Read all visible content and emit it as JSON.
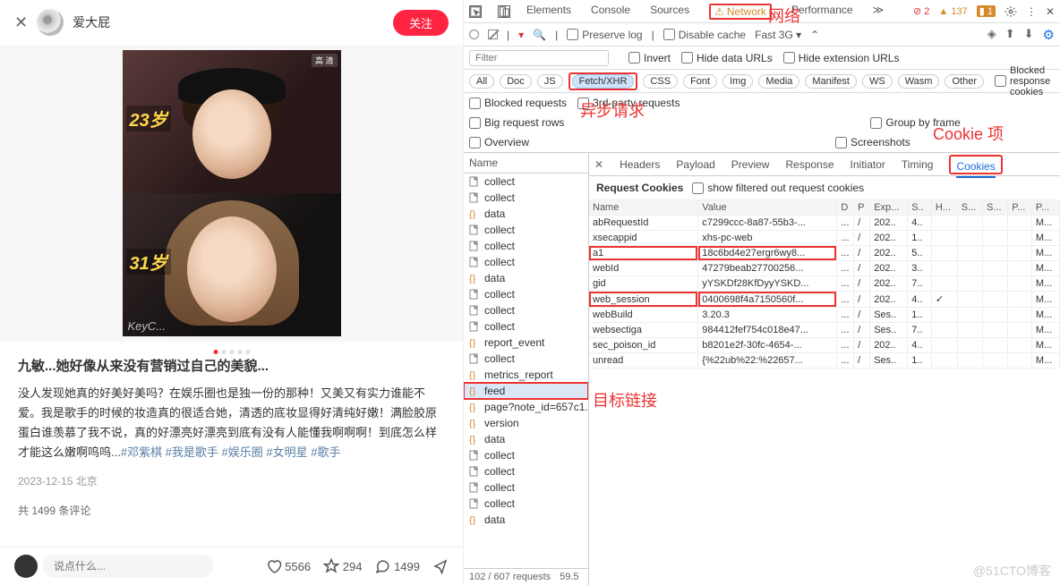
{
  "left": {
    "username": "爱大屁",
    "follow": "关注",
    "age1": "23岁",
    "age2": "31岁",
    "hd": "高 清",
    "sig": "KeyC...",
    "title": "九敏...她好像从来没有营销过自己的美貌...",
    "body": "没人发现她真的好美好美吗？在娱乐圈也是独一份的那种！又美又有实力谁能不爱。我是歌手的时候的妆造真的很适合她，清透的底妆显得好清纯好嫩！满脸胶原蛋白谁羡慕了我不说，真的好漂亮好漂亮到底有没有人能懂我啊啊啊！到底怎么样才能这么嫩啊呜呜...",
    "tags": "#邓紫棋 #我是歌手 #娱乐圈 #女明星 #歌手",
    "meta": "2023-12-15 北京",
    "comments_line": "共 1499 条评论",
    "placeholder": "说点什么...",
    "likes": "5566",
    "stars": "294",
    "cmts": "1499"
  },
  "dev": {
    "tabs": [
      "Elements",
      "Console",
      "Sources",
      "Network",
      "Performance"
    ],
    "err": "2",
    "warn": "137",
    "info": "1",
    "toolbar": {
      "preserve": "Preserve log",
      "disable": "Disable cache",
      "throttle": "Fast 3G"
    },
    "filter_placeholder": "Filter",
    "invert": "Invert",
    "hide_urls": "Hide data URLs",
    "hide_ext": "Hide extension URLs",
    "chips": [
      "All",
      "Doc",
      "JS",
      "Fetch/XHR",
      "CSS",
      "Font",
      "Img",
      "Media",
      "Manifest",
      "WS",
      "Wasm",
      "Other"
    ],
    "blocked_cookies": "Blocked response cookies",
    "opts": {
      "blocked": "Blocked requests",
      "third": "3rd-party requests",
      "big": "Big request rows",
      "group": "Group by frame",
      "overview": "Overview",
      "screens": "Screenshots"
    },
    "name_hdr": "Name",
    "requests": [
      {
        "t": "f",
        "n": "collect"
      },
      {
        "t": "f",
        "n": "collect"
      },
      {
        "t": "x",
        "n": "data"
      },
      {
        "t": "f",
        "n": "collect"
      },
      {
        "t": "f",
        "n": "collect"
      },
      {
        "t": "f",
        "n": "collect"
      },
      {
        "t": "x",
        "n": "data"
      },
      {
        "t": "f",
        "n": "collect"
      },
      {
        "t": "f",
        "n": "collect"
      },
      {
        "t": "f",
        "n": "collect"
      },
      {
        "t": "x",
        "n": "report_event"
      },
      {
        "t": "f",
        "n": "collect"
      },
      {
        "t": "x",
        "n": "metrics_report"
      },
      {
        "t": "x",
        "n": "feed",
        "sel": true
      },
      {
        "t": "x",
        "n": "page?note_id=657c1..."
      },
      {
        "t": "x",
        "n": "version"
      },
      {
        "t": "x",
        "n": "data"
      },
      {
        "t": "f",
        "n": "collect"
      },
      {
        "t": "f",
        "n": "collect"
      },
      {
        "t": "f",
        "n": "collect"
      },
      {
        "t": "f",
        "n": "collect"
      },
      {
        "t": "x",
        "n": "data"
      }
    ],
    "req_count": "102 / 607 requests",
    "req_size": "59.5",
    "det_tabs": [
      "Headers",
      "Payload",
      "Preview",
      "Response",
      "Initiator",
      "Timing",
      "Cookies"
    ],
    "req_cookies": "Request Cookies",
    "show_filtered": "show filtered out request cookies",
    "cols": [
      "Name",
      "Value",
      "D",
      "P",
      "Exp...",
      "S..",
      "H...",
      "S...",
      "S...",
      "P...",
      "P..."
    ],
    "rows": [
      {
        "n": "abRequestId",
        "v": "c7299ccc-8a87-55b3-...",
        "d": "...",
        "p": "/",
        "e": "202..",
        "s": "4..",
        "h": "",
        "sa": "",
        "sc": "",
        "pr": "",
        "pa": "M..."
      },
      {
        "n": "xsecappid",
        "v": "xhs-pc-web",
        "d": "...",
        "p": "/",
        "e": "202..",
        "s": "1..",
        "h": "",
        "sa": "",
        "sc": "",
        "pr": "",
        "pa": "M..."
      },
      {
        "n": "a1",
        "v": "18c6bd4e27ergr6wy8...",
        "d": "...",
        "p": "/",
        "e": "202..",
        "s": "5..",
        "h": "",
        "sa": "",
        "sc": "",
        "pr": "",
        "pa": "M...",
        "hl": true
      },
      {
        "n": "webId",
        "v": "47279beab27700256...",
        "d": "...",
        "p": "/",
        "e": "202..",
        "s": "3..",
        "h": "",
        "sa": "",
        "sc": "",
        "pr": "",
        "pa": "M..."
      },
      {
        "n": "gid",
        "v": "yYSKDf28KfDyyYSKD...",
        "d": "...",
        "p": "/",
        "e": "202..",
        "s": "7..",
        "h": "",
        "sa": "",
        "sc": "",
        "pr": "",
        "pa": "M..."
      },
      {
        "n": "web_session",
        "v": "0400698f4a7150560f...",
        "d": "...",
        "p": "/",
        "e": "202..",
        "s": "4..",
        "h": "✓",
        "sa": "",
        "sc": "",
        "pr": "",
        "pa": "M...",
        "hl": true
      },
      {
        "n": "webBuild",
        "v": "3.20.3",
        "d": "...",
        "p": "/",
        "e": "Ses..",
        "s": "1..",
        "h": "",
        "sa": "",
        "sc": "",
        "pr": "",
        "pa": "M..."
      },
      {
        "n": "websectiga",
        "v": "984412fef754c018e47...",
        "d": "...",
        "p": "/",
        "e": "Ses..",
        "s": "7..",
        "h": "",
        "sa": "",
        "sc": "",
        "pr": "",
        "pa": "M..."
      },
      {
        "n": "sec_poison_id",
        "v": "b8201e2f-30fc-4654-...",
        "d": "...",
        "p": "/",
        "e": "202..",
        "s": "4..",
        "h": "",
        "sa": "",
        "sc": "",
        "pr": "",
        "pa": "M..."
      },
      {
        "n": "unread",
        "v": "{%22ub%22:%22657...",
        "d": "...",
        "p": "/",
        "e": "Ses..",
        "s": "1..",
        "h": "",
        "sa": "",
        "sc": "",
        "pr": "",
        "pa": "M..."
      }
    ]
  },
  "ann": {
    "net": "网络",
    "xhr": "异步请求",
    "cookie": "Cookie 项",
    "target": "目标链接"
  },
  "watermark": "@51CTO博客"
}
